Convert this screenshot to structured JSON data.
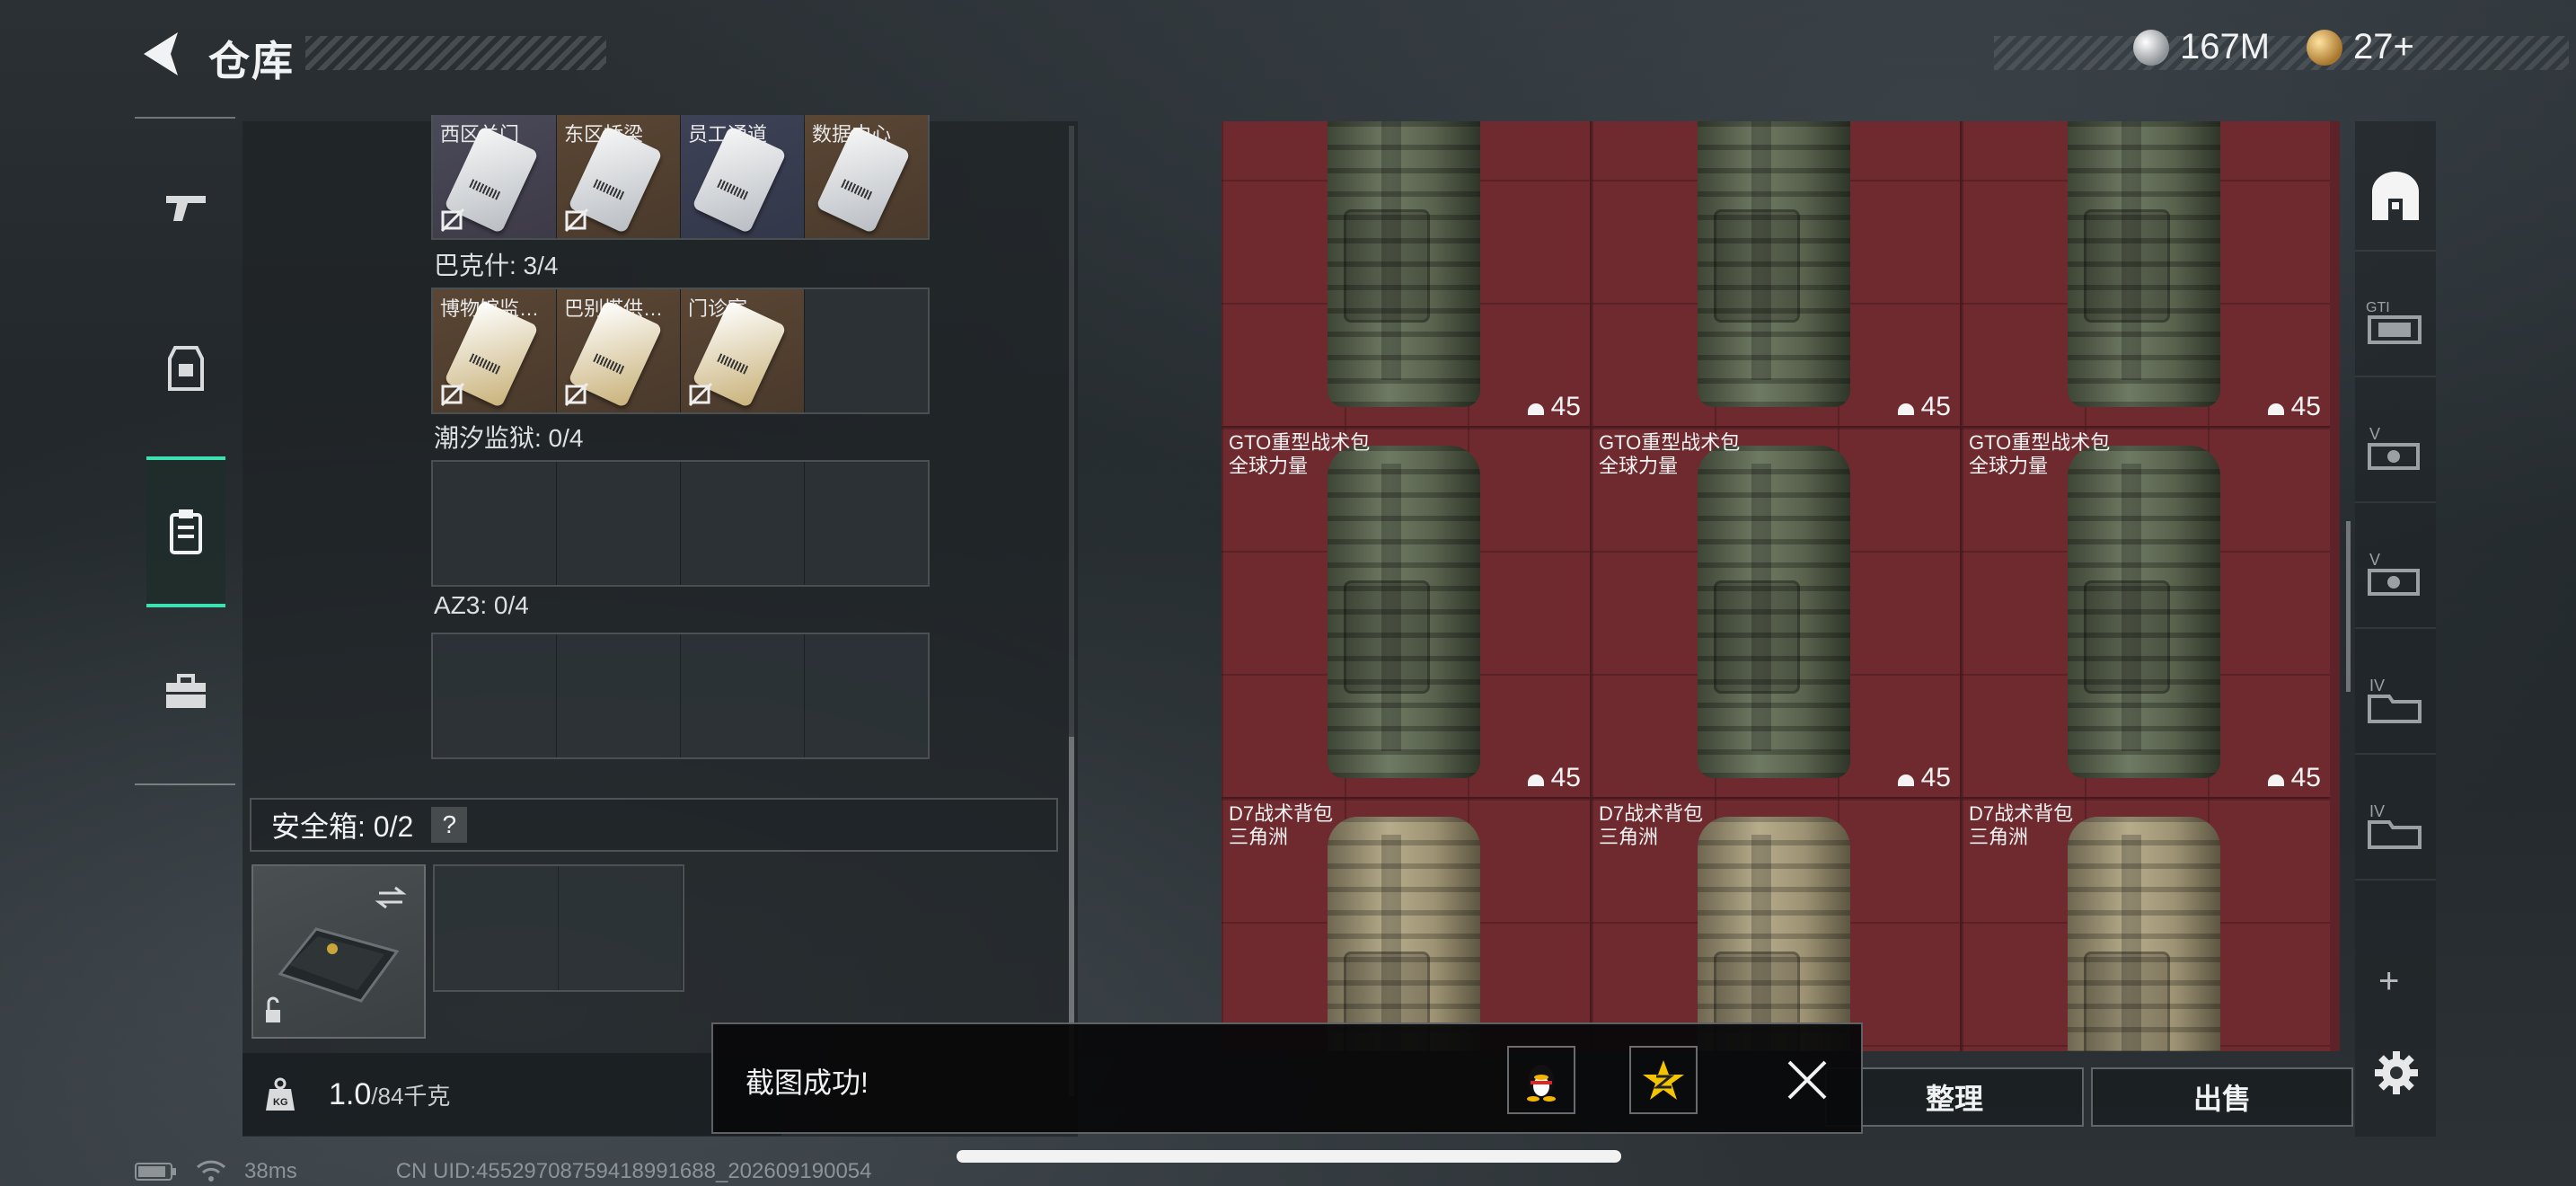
{
  "header": {
    "title": "仓库",
    "currencies": [
      {
        "icon": "silver-coin-icon",
        "value": "167M"
      },
      {
        "icon": "gold-coin-icon",
        "value": "27+"
      }
    ]
  },
  "left_rail": {
    "tabs": [
      {
        "icon": "pistol-icon",
        "active": false
      },
      {
        "icon": "armor-vest-icon",
        "active": false
      },
      {
        "icon": "keycard-case-icon",
        "active": true
      },
      {
        "icon": "toolbox-icon",
        "active": false
      }
    ]
  },
  "stash": {
    "top_row": [
      {
        "name": "西区关门"
      },
      {
        "name": "东区桥梁"
      },
      {
        "name": "员工通道"
      },
      {
        "name": "数据中心"
      }
    ],
    "sections": [
      {
        "label": "巴克什: 3/4",
        "items": [
          {
            "name": "博物馆监…"
          },
          {
            "name": "巴别塔供…"
          },
          {
            "name": "门诊室"
          }
        ]
      },
      {
        "label": "潮汐监狱: 0/4",
        "items": []
      },
      {
        "label": "AZ3: 0/4",
        "items": []
      }
    ],
    "safe_box": {
      "label": "安全箱: 0/2",
      "help": "?"
    },
    "weight": {
      "value": "1.0",
      "max": "/84千克"
    }
  },
  "inventory": {
    "rows": [
      [
        {
          "name": "",
          "brand": "",
          "count": "45",
          "color": "green"
        },
        {
          "name": "",
          "brand": "",
          "count": "45",
          "color": "green"
        },
        {
          "name": "",
          "brand": "",
          "count": "45",
          "color": "green"
        }
      ],
      [
        {
          "name": "GTO重型战术包",
          "brand": "全球力量",
          "count": "45",
          "color": "green"
        },
        {
          "name": "GTO重型战术包",
          "brand": "全球力量",
          "count": "45",
          "color": "green"
        },
        {
          "name": "GTO重型战术包",
          "brand": "全球力量",
          "count": "45",
          "color": "green"
        }
      ],
      [
        {
          "name": "D7战术背包",
          "brand": "三角洲",
          "count": "",
          "color": "tan"
        },
        {
          "name": "D7战术背包",
          "brand": "三角洲",
          "count": "",
          "color": "tan"
        },
        {
          "name": "D7战术背包",
          "brand": "三角洲",
          "count": "",
          "color": "tan"
        }
      ]
    ],
    "buttons": {
      "sort": "整理",
      "sell": "出售"
    }
  },
  "right_rail": {
    "categories": [
      {
        "icon": "all-items-icon"
      },
      {
        "icon": "gt-backpack-icon"
      },
      {
        "icon": "v-rig-icon"
      },
      {
        "icon": "v-rig-icon"
      },
      {
        "icon": "iv-case-icon"
      },
      {
        "icon": "iv-case-icon"
      }
    ],
    "add": "+"
  },
  "toast": {
    "message": "截图成功!",
    "close": "close"
  },
  "status_bar": {
    "ping": "38ms",
    "uid": "CN UID:4552970875941899168​8_202609190054"
  },
  "colors": {
    "accent": "#3de0b0",
    "inventory_bg": "#6e2a2f"
  }
}
